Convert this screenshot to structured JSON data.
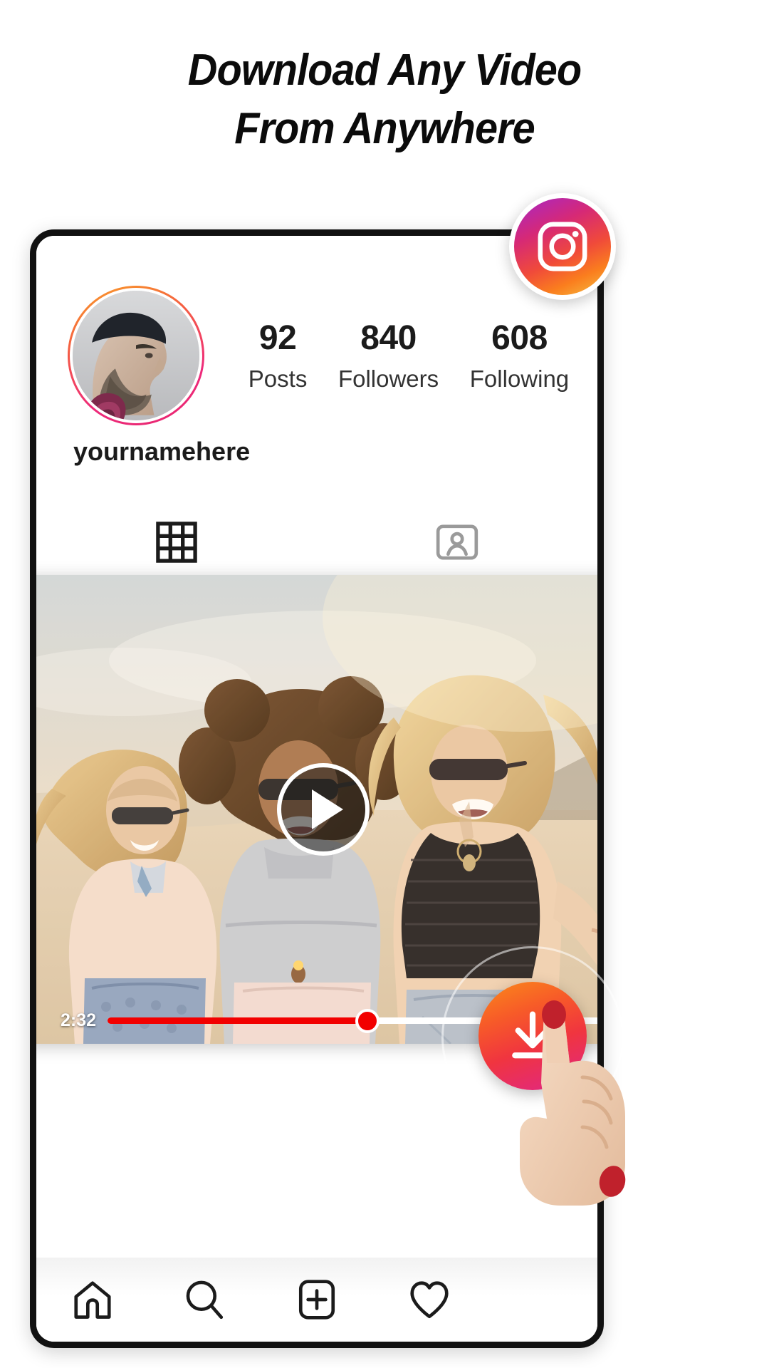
{
  "headline": {
    "line1": "Download Any Video",
    "line2": "From Anywhere"
  },
  "badge": {
    "icon": "instagram-camera-icon",
    "gradient": [
      "#a626c9",
      "#d62976",
      "#f04a3a",
      "#fa7e1e",
      "#f5c344"
    ]
  },
  "profile": {
    "avatar_icon": "user-avatar-photo",
    "avatar_ring_gradient": [
      "#f9a227",
      "#f56040",
      "#ee2a7b"
    ],
    "username": "yournamehere",
    "stats": [
      {
        "value": "92",
        "label": "Posts"
      },
      {
        "value": "840",
        "label": "Followers"
      },
      {
        "value": "608",
        "label": "Following"
      }
    ],
    "tabs": [
      {
        "icon": "grid-icon",
        "active": true,
        "label": "Grid"
      },
      {
        "icon": "tagged-icon",
        "active": false,
        "label": "Tagged"
      }
    ]
  },
  "video": {
    "thumbnail_alt": "three women walking on a beach",
    "play_icon": "play-icon",
    "current_time": "2:32",
    "progress_percent": 52,
    "progress_color": "#f20000",
    "track_color": "#ffffff"
  },
  "bottom_nav": [
    {
      "icon": "home-icon",
      "label": "Home"
    },
    {
      "icon": "search-icon",
      "label": "Search"
    },
    {
      "icon": "add-post-icon",
      "label": "New Post"
    },
    {
      "icon": "heart-icon",
      "label": "Activity"
    }
  ],
  "download_button": {
    "icon": "download-icon",
    "gradient": [
      "#fb8b1a",
      "#f0353f",
      "#d92b8a"
    ]
  }
}
